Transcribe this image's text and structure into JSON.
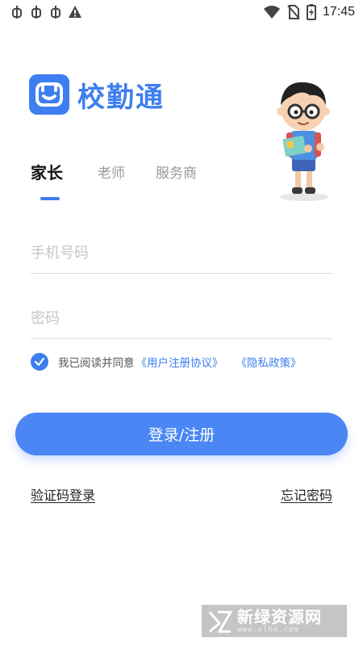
{
  "status_bar": {
    "time": "17:45",
    "left_icons": [
      "bug-icon",
      "bug-icon",
      "bug-icon",
      "warning-icon"
    ],
    "right_icons": [
      "wifi-icon",
      "no-sim-icon",
      "battery-icon"
    ]
  },
  "app": {
    "name": "校勤通",
    "brand_color": "#3d7ef0"
  },
  "tabs": [
    {
      "label": "家长",
      "active": true
    },
    {
      "label": "老师",
      "active": false
    },
    {
      "label": "服务商",
      "active": false
    }
  ],
  "form": {
    "phone_placeholder": "手机号码",
    "password_placeholder": "密码",
    "agreement": {
      "checked": true,
      "text": "我已阅读并同意",
      "user_agreement": "《用户注册协议》",
      "privacy_policy": "《隐私政策》"
    },
    "submit_label": "登录/注册"
  },
  "links": {
    "code_login": "验证码登录",
    "forgot_password": "忘记密码"
  },
  "watermark": {
    "title": "新绿资源网",
    "subtitle": "www.xlhs.com"
  }
}
